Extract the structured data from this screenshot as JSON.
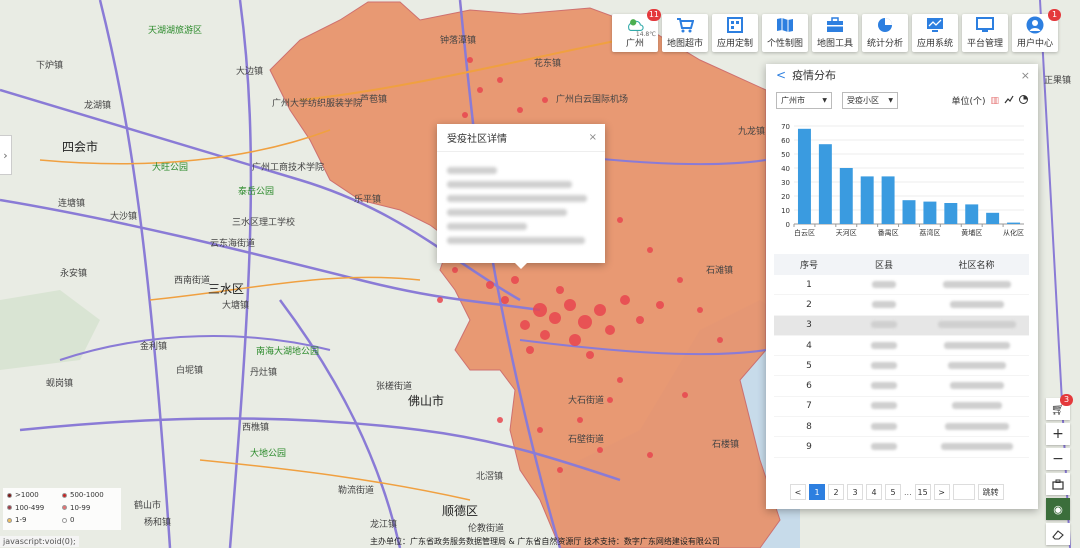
{
  "map": {
    "labels": [
      {
        "text": "天湖湖旅游区",
        "cls": "green"
      },
      {
        "text": "大边镇",
        "cls": ""
      },
      {
        "text": "下炉镇",
        "cls": ""
      },
      {
        "text": "龙湖镇",
        "cls": ""
      },
      {
        "text": "广州大学纺织服装学院",
        "cls": ""
      },
      {
        "text": "芦苞镇",
        "cls": ""
      },
      {
        "text": "四会市",
        "cls": "big"
      },
      {
        "text": "大旺公园",
        "cls": "green"
      },
      {
        "text": "广州工商技术学院",
        "cls": ""
      },
      {
        "text": "泰岳公园",
        "cls": "green"
      },
      {
        "text": "连塘镇",
        "cls": ""
      },
      {
        "text": "大沙镇",
        "cls": ""
      },
      {
        "text": "三水区理工学校",
        "cls": ""
      },
      {
        "text": "乐平镇",
        "cls": ""
      },
      {
        "text": "云东海街道",
        "cls": ""
      },
      {
        "text": "永安镇",
        "cls": ""
      },
      {
        "text": "西南街道",
        "cls": ""
      },
      {
        "text": "三水区",
        "cls": "big"
      },
      {
        "text": "大塘镇",
        "cls": ""
      },
      {
        "text": "金利镇",
        "cls": ""
      },
      {
        "text": "南海大湖地公园",
        "cls": "green"
      },
      {
        "text": "白坭镇",
        "cls": ""
      },
      {
        "text": "丹灶镇",
        "cls": ""
      },
      {
        "text": "蚬岗镇",
        "cls": ""
      },
      {
        "text": "佛山市",
        "cls": "big"
      },
      {
        "text": "张槎街道",
        "cls": ""
      },
      {
        "text": "西樵镇",
        "cls": ""
      },
      {
        "text": "大地公园",
        "cls": "green"
      },
      {
        "text": "北滘镇",
        "cls": ""
      },
      {
        "text": "伦教街道",
        "cls": ""
      },
      {
        "text": "龙江镇",
        "cls": ""
      },
      {
        "text": "勒流街道",
        "cls": ""
      },
      {
        "text": "顺德区",
        "cls": "big"
      },
      {
        "text": "鹤山市",
        "cls": ""
      },
      {
        "text": "杨和镇",
        "cls": ""
      },
      {
        "text": "花东镇",
        "cls": ""
      },
      {
        "text": "钟落潭镇",
        "cls": ""
      },
      {
        "text": "广州白云国际机场",
        "cls": ""
      },
      {
        "text": "九龙镇",
        "cls": ""
      },
      {
        "text": "石滩镇",
        "cls": ""
      },
      {
        "text": "正果镇",
        "cls": ""
      },
      {
        "text": "大石街道",
        "cls": ""
      },
      {
        "text": "石壁街道",
        "cls": ""
      },
      {
        "text": "石楼镇",
        "cls": ""
      }
    ]
  },
  "popup": {
    "title": "受疫社区详情",
    "close": "×"
  },
  "toolbar": [
    {
      "name": "weather",
      "label": "广州",
      "sub": "14.8℃",
      "badge": "11"
    },
    {
      "name": "map-supermarket",
      "label": "地图超市"
    },
    {
      "name": "app-custom",
      "label": "应用定制"
    },
    {
      "name": "personal-map",
      "label": "个性制图"
    },
    {
      "name": "map-tools",
      "label": "地图工具"
    },
    {
      "name": "statistics",
      "label": "统计分析"
    },
    {
      "name": "app-system",
      "label": "应用系统"
    },
    {
      "name": "platform-mgmt",
      "label": "平台管理"
    },
    {
      "name": "user-center",
      "label": "用户中心",
      "badge": "1"
    }
  ],
  "panel": {
    "title": "疫情分布",
    "back": "<",
    "close": "×",
    "city_select": "广州市",
    "type_select": "受疫小区",
    "unit": "单位(个)",
    "table_headers": [
      "序号",
      "区县",
      "社区名称"
    ],
    "rows": [
      {
        "no": "1",
        "sel": false
      },
      {
        "no": "2",
        "sel": false
      },
      {
        "no": "3",
        "sel": true
      },
      {
        "no": "4",
        "sel": false
      },
      {
        "no": "5",
        "sel": false
      },
      {
        "no": "6",
        "sel": false
      },
      {
        "no": "7",
        "sel": false
      },
      {
        "no": "8",
        "sel": false
      },
      {
        "no": "9",
        "sel": false
      }
    ],
    "pager": {
      "prev": "<",
      "pages": [
        "1",
        "2",
        "3",
        "4",
        "5"
      ],
      "active": "1",
      "ellipsis": "...",
      "last": "15",
      "next": ">",
      "jump": "跳转"
    }
  },
  "chart_data": {
    "type": "bar",
    "categories": [
      "白云区",
      "天河区",
      "番禺区",
      "荔湾区",
      "黄埔区",
      "从化区"
    ],
    "category_slots": 11,
    "values": [
      68,
      57,
      40,
      34,
      34,
      17,
      16,
      15,
      14,
      8,
      1
    ],
    "ylim": [
      0,
      70
    ],
    "yticks": [
      0,
      10,
      20,
      30,
      40,
      50,
      60,
      70
    ],
    "color": "#3a9be0",
    "grid": true
  },
  "legend": [
    {
      "label": ">1000",
      "color": "#7a1a1a"
    },
    {
      "label": "500-1000",
      "color": "#c62828"
    },
    {
      "label": "100-499",
      "color": "#a0404a"
    },
    {
      "label": "10-99",
      "color": "#e57373"
    },
    {
      "label": "1-9",
      "color": "#f0c060"
    },
    {
      "label": "0",
      "color": "#ffffff"
    }
  ],
  "status": {
    "url": "javascript:void(0);",
    "footer": "主办单位：广东省政务服务数据管理局 & 广东省自然资源厅    技术支持：数字广东网络建设有限公司"
  },
  "colors": {
    "accent": "#2d7fe0",
    "epidemic_fill": "#e8926a",
    "dot": "#e8464f"
  }
}
